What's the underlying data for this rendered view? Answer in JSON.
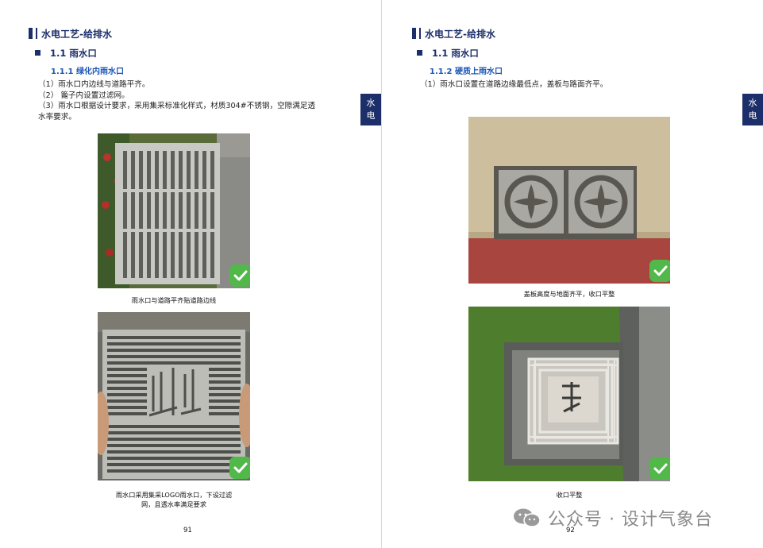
{
  "left_page": {
    "section_title": "水电工艺-给排水",
    "heading2": "1.1 雨水口",
    "heading3": "1.1.1 绿化内雨水口",
    "paragraphs": [
      "（1）雨水口内边线与道路平齐。",
      "（2） 篦子内设置过滤网。",
      "（3）雨水口根据设计要求，采用集采标准化样式，材质304#不锈钢，空隙满足透",
      "水率要求。"
    ],
    "side_tab": [
      "水",
      "电"
    ],
    "photo1_caption": "雨水口与道路平齐贴道路边线",
    "photo2_caption_lines": [
      "雨水口采用集采LOGO雨水口，下设过滤",
      "网，且透水率满足要求"
    ],
    "page_number": "91"
  },
  "right_page": {
    "section_title": "水电工艺-给排水",
    "heading2": "1.1 雨水口",
    "heading3": "1.1.2  硬质上雨水口",
    "paragraphs": [
      "（1）雨水口设置在道路边缘最低点，盖板与路面齐平。"
    ],
    "side_tab": [
      "水",
      "电"
    ],
    "photo1_caption": "盖板高度与地面齐平，收口平整",
    "photo2_caption": "收口平整",
    "page_number": "92"
  },
  "watermark": {
    "text": "公众号 · 设计气象台",
    "icon": "wechat-icon"
  },
  "colors": {
    "navy": "#1c2f6b",
    "blue": "#1c57b5",
    "check_green": "#52b84a"
  }
}
